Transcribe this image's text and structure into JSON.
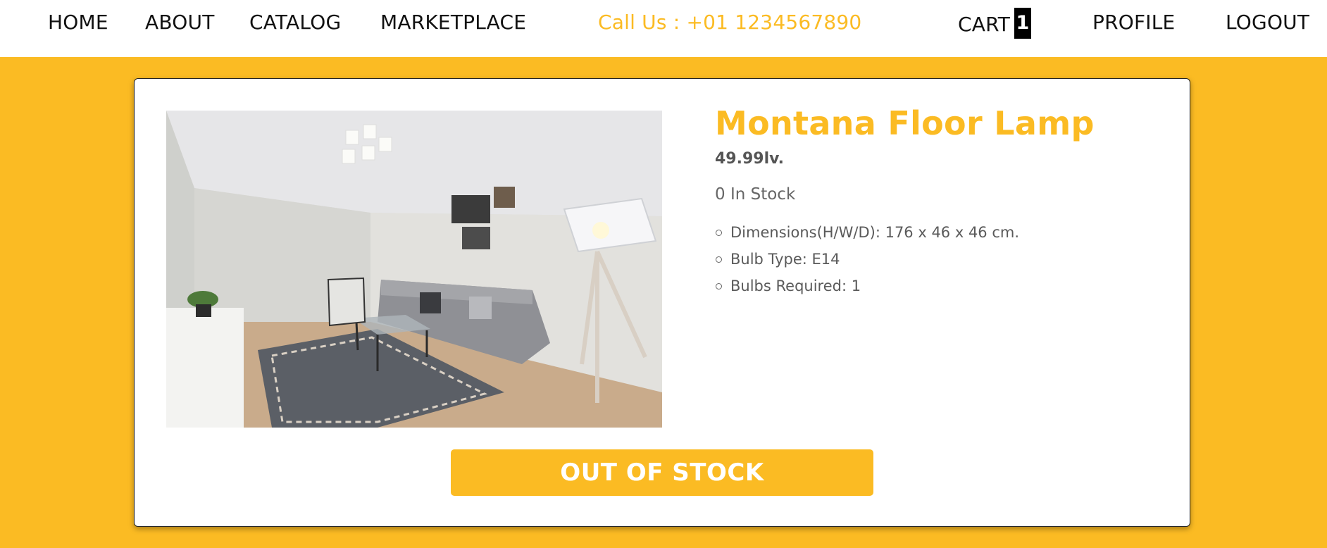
{
  "nav": {
    "home": "HOME",
    "about": "ABOUT",
    "catalog": "CATALOG",
    "marketplace": "MARKETPLACE",
    "phone": "Call Us : +01 1234567890",
    "cart": "CART",
    "cart_count": "1",
    "profile": "PROFILE",
    "logout": "LOGOUT"
  },
  "product": {
    "title": "Montana Floor Lamp",
    "price": "49.99lv.",
    "stock": "0 In Stock",
    "specs": [
      "Dimensions(H/W/D): 176 x 46 x 46 cm.",
      "Bulb Type: E14",
      "Bulbs Required: 1"
    ],
    "button_label": "OUT OF STOCK",
    "image_icon": "living-room-photo"
  },
  "colors": {
    "accent": "#fbbb23",
    "background": "#fbbb23",
    "card": "#ffffff",
    "badge": "#000000"
  }
}
